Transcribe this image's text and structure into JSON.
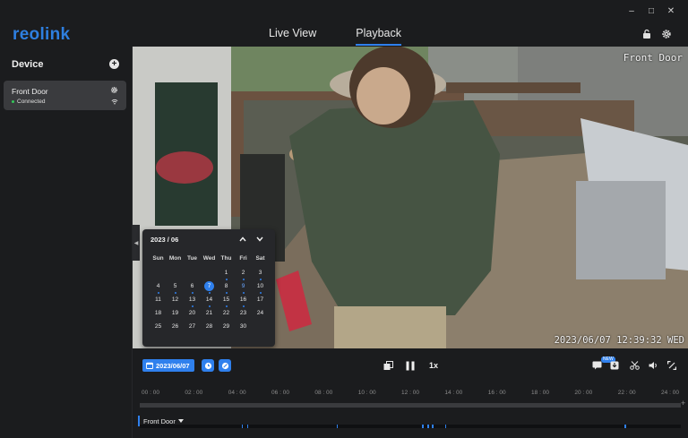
{
  "app": {
    "logo_text": "reolink",
    "window_controls": [
      "–",
      "□",
      "✕"
    ],
    "tabs": [
      {
        "label": "Live View",
        "active": false
      },
      {
        "label": "Playback",
        "active": true
      }
    ],
    "icons": [
      "lock-icon",
      "gear-icon"
    ]
  },
  "sidebar": {
    "title": "Device",
    "add_icon": "+",
    "device": {
      "name": "Front Door",
      "status": "Connected"
    }
  },
  "video": {
    "osd_name": "Front Door",
    "osd_time": "2023/06/07 12:39:32 WED",
    "collapse_icon": "◀"
  },
  "calendar": {
    "header": "2023 / 06",
    "weekdays": [
      "Sun",
      "Mon",
      "Tue",
      "Wed",
      "Thu",
      "Fri",
      "Sat"
    ],
    "first_weekday_index": 4,
    "days_in_month": 30,
    "selected_day": 7,
    "highlighted_days": [
      9
    ],
    "days_with_recordings": [
      1,
      2,
      3,
      4,
      5,
      6,
      7,
      8,
      9,
      10,
      13,
      14,
      15,
      16
    ]
  },
  "controls": {
    "date_label": "2023/06/07",
    "speed_label": "1x",
    "new_badge": "NEW"
  },
  "timeline": {
    "ticks": [
      "00 : 00",
      "02 : 00",
      "04 : 00",
      "06 : 00",
      "08 : 00",
      "10 : 00",
      "12 : 00",
      "14 : 00",
      "16 : 00",
      "18 : 00",
      "20 : 00",
      "22 : 00",
      "24 : 00"
    ],
    "plus_label": "+",
    "device_label": "Front Door",
    "recording_hours": [
      4.2,
      4.45,
      8.6,
      12.55,
      12.8,
      13.0,
      13.6,
      21.9
    ]
  },
  "colors": {
    "accent": "#2f80ed",
    "background": "#1b1c1e",
    "card": "#3a3b3e",
    "online": "#35c759"
  }
}
